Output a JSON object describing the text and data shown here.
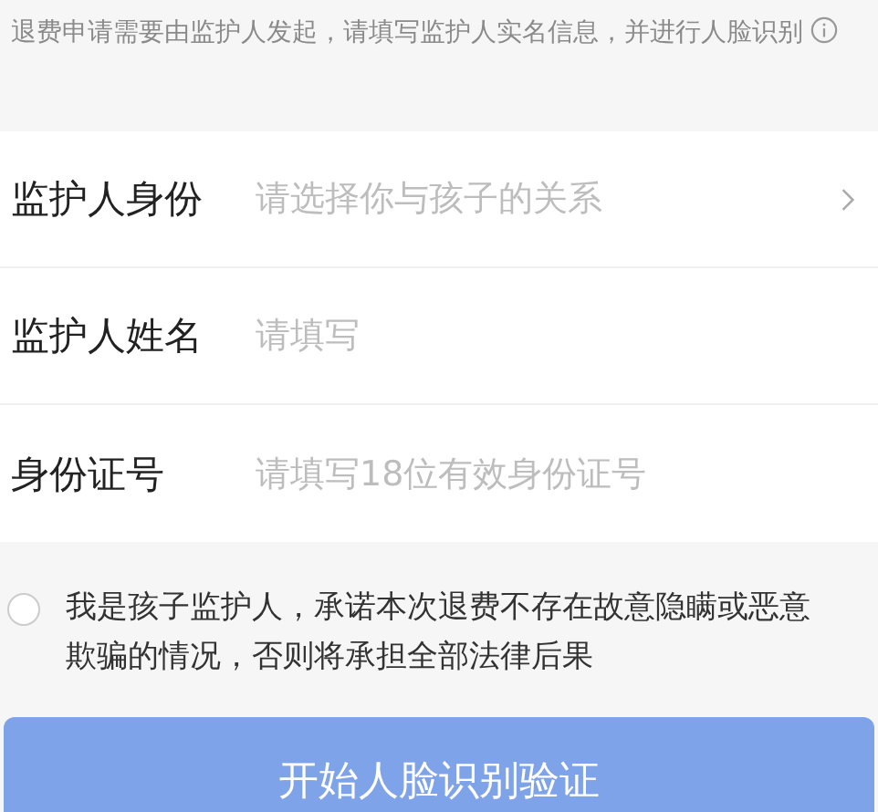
{
  "notice": {
    "text": "退费申请需要由监护人发起，请填写监护人实名信息，并进行人脸识别"
  },
  "fields": [
    {
      "label": "监护人身份",
      "placeholder": "请选择你与孩子的关系",
      "kind": "select"
    },
    {
      "label": "监护人姓名",
      "placeholder": "请填写",
      "kind": "text"
    },
    {
      "label": "身份证号",
      "placeholder": "请填写18位有效身份证号",
      "kind": "text"
    }
  ],
  "agreement": {
    "text": "我是孩子监护人，承诺本次退费不存在故意隐瞒或恶意欺骗的情况，否则将承担全部法律后果",
    "checked": false
  },
  "submit": {
    "label": "开始人脸识别验证",
    "disabled": true
  }
}
